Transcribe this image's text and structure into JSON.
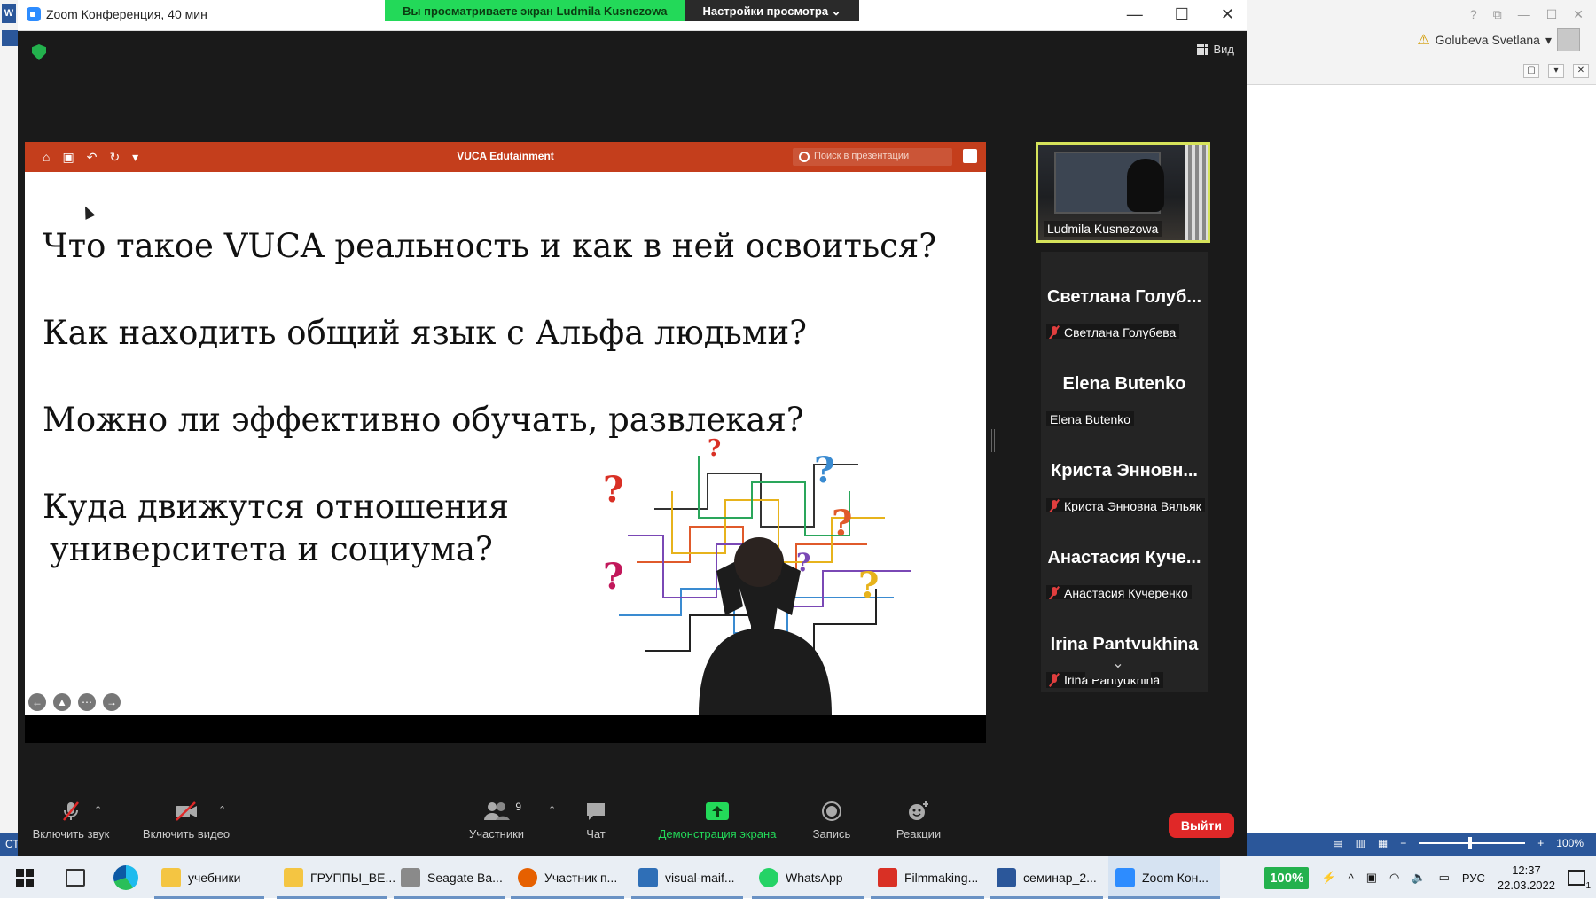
{
  "zoom": {
    "window_title": "Zoom Конференция, 40 мин",
    "share_banner_text": "Вы просматриваете экран Ludmila Kusnezowa",
    "view_settings_label": "Настройки просмотра ⌄",
    "view_label": "Вид",
    "window_buttons": [
      "—",
      "☐",
      "✕"
    ]
  },
  "presentation": {
    "doc_title": "VUCA Edutainment",
    "search_placeholder": "Поиск в презентации",
    "lines": [
      "Что такое VUCA реальность и как в ней освоиться?",
      "Как находить общий язык с Альфа людьми?",
      "Можно ли эффективно обучать, развлекая?",
      "Куда движутся отношения",
      " университета и социума?"
    ]
  },
  "participants": {
    "active": {
      "name": "Ludmila Kusnezowa"
    },
    "tiles": [
      {
        "big": "Светлана Голуб...",
        "small": "Светлана Голубева",
        "muted": true
      },
      {
        "big": "Elena Butenko",
        "small": "Elena Butenko",
        "muted": false
      },
      {
        "big": "Криста Энновн...",
        "small": "Криста Энновна Вяльяк",
        "muted": true
      },
      {
        "big": "Анастасия Куче...",
        "small": "Анастасия Кучеренко",
        "muted": true
      },
      {
        "big": "Irina Pantyukhina",
        "small": "Irina Pantyukhina",
        "muted": true
      }
    ]
  },
  "toolbar": {
    "unmute_label": "Включить звук",
    "video_label": "Включить видео",
    "participants_label": "Участники",
    "participants_count": "9",
    "chat_label": "Чат",
    "share_label": "Демонстрация экрана",
    "record_label": "Запись",
    "reactions_label": "Реакции",
    "leave_label": "Выйти"
  },
  "word": {
    "user_name": "Golubeva Svetlana",
    "status_left": "СТ",
    "zoom_level": "100%",
    "top_buttons": [
      "?",
      "⧉",
      "—",
      "☐",
      "✕"
    ]
  },
  "taskbar": {
    "items": [
      {
        "label": "учебники",
        "color": "#f4c542"
      },
      {
        "label": "ГРУППЫ_ВЕ...",
        "color": "#f4c542"
      },
      {
        "label": "Seagate Ba...",
        "color": "#8a8a8a"
      },
      {
        "label": "Участник п...",
        "color": "#e66000"
      },
      {
        "label": "visual-maif...",
        "color": "#2f6fb7"
      },
      {
        "label": "WhatsApp",
        "color": "#25d366"
      },
      {
        "label": "Filmmaking...",
        "color": "#d93025"
      },
      {
        "label": "семинар_2...",
        "color": "#2b579a"
      },
      {
        "label": "Zoom Кон...",
        "color": "#2d8cff"
      }
    ],
    "battery": "100%",
    "language": "РУС",
    "time": "12:37",
    "date": "22.03.2022",
    "notifications": "1"
  }
}
